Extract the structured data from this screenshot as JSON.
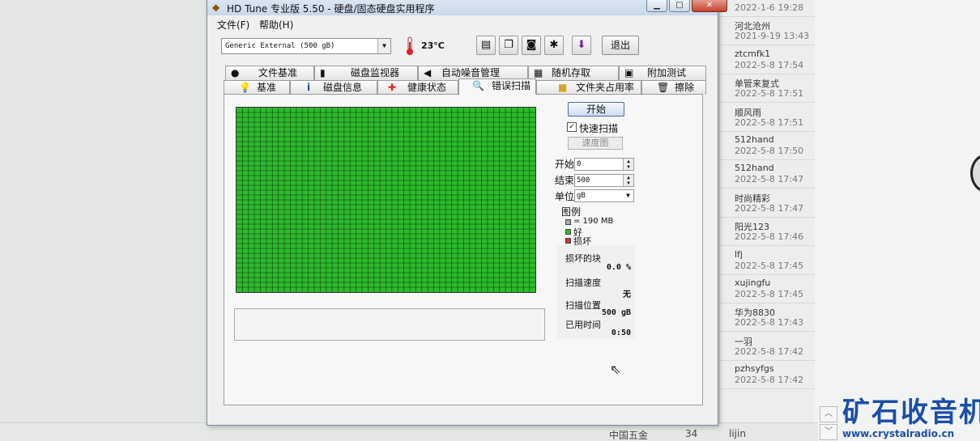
{
  "window": {
    "title": "HD Tune 专业版 5.50 - 硬盘/固态硬盘实用程序",
    "menu": [
      "文件(F)",
      "帮助(H)"
    ],
    "drive": "Generic External  (500 gB)",
    "temperature": "23°C",
    "exit_label": "退出"
  },
  "tabs_top": [
    "文件基准",
    "磁盘监视器",
    "自动噪音管理",
    "随机存取",
    "附加测试"
  ],
  "tabs_bottom": [
    "基准",
    "磁盘信息",
    "健康状态",
    "错误扫描",
    "文件夹占用率",
    "擦除"
  ],
  "active_tab": "错误扫描",
  "scan": {
    "start_label": "开始",
    "quick_scan_label": "快速扫描",
    "quick_scan_checked": true,
    "speed_map_label": "速度图",
    "start_field_label": "开始",
    "start_value": "0",
    "end_field_label": "结束",
    "end_value": "500",
    "unit_label": "单位",
    "unit_value": "gB",
    "legend_title": "图例",
    "legend_block": "= 190 MB",
    "legend_good": "好",
    "legend_bad": "损坏",
    "damaged_label": "损坏的块",
    "damaged_value": "0.0 %",
    "speed_label": "扫描速度",
    "speed_value": "无",
    "position_label": "扫描位置",
    "position_value": "500 gB",
    "elapsed_label": "已用时间",
    "elapsed_value": "0:50",
    "grid_color": "#2bbb2b",
    "bad_color": "#d03030"
  },
  "side_list": [
    {
      "name": "",
      "date": "2022-1-6 19:28"
    },
    {
      "name": "河北沧州",
      "date": "2021-9-19 13:43"
    },
    {
      "name": "ztcmfk1",
      "date": "2022-5-8 17:54"
    },
    {
      "name": "单管来复式",
      "date": "2022-5-8 17:51"
    },
    {
      "name": "顺风雨",
      "date": "2022-5-8 17:51"
    },
    {
      "name": "512hand",
      "date": "2022-5-8 17:50"
    },
    {
      "name": "512hand",
      "date": "2022-5-8 17:47"
    },
    {
      "name": "时尚精彩",
      "date": "2022-5-8 17:47"
    },
    {
      "name": "阳光123",
      "date": "2022-5-8 17:46"
    },
    {
      "name": "lfj",
      "date": "2022-5-8 17:45"
    },
    {
      "name": "xujingfu",
      "date": "2022-5-8 17:45"
    },
    {
      "name": "华为8830",
      "date": "2022-5-8 17:43"
    },
    {
      "name": "一羽",
      "date": "2022-5-8 17:42"
    },
    {
      "name": "pzhsyfgs",
      "date": "2022-5-8 17:42"
    }
  ],
  "bottom_strip": [
    "中国五金",
    "34",
    "lijin"
  ],
  "watermark": {
    "brand": "矿石收音机",
    "url": "www.crystalradio.cn"
  }
}
